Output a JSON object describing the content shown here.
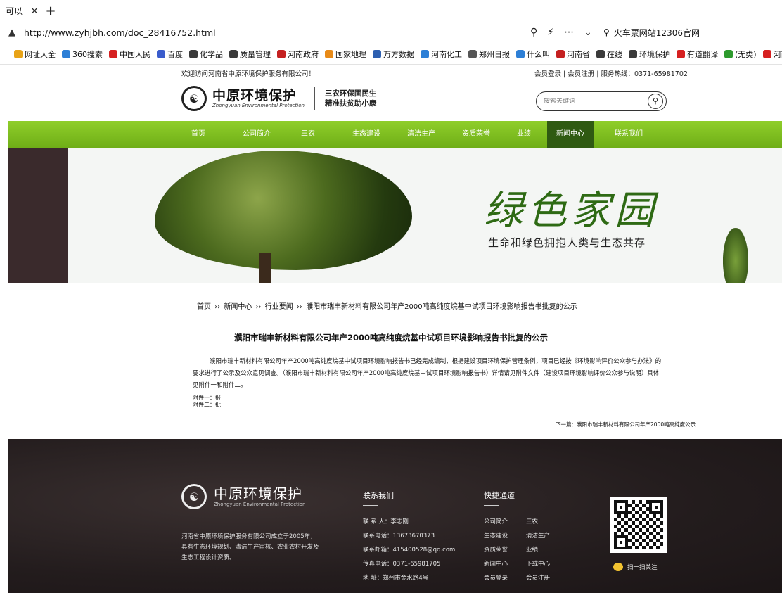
{
  "browser": {
    "tab_title": "可以",
    "tab_close": "×",
    "tab_new": "+",
    "url": "http://www.zyhjbh.com/doc_28416752.html",
    "zoom_icon": "zoom-icon",
    "search_text": "火车票网站12306官网",
    "bookmarks": [
      {
        "label": "网址大全",
        "color": "#e8a317"
      },
      {
        "label": "360搜索",
        "color": "#2d7fd6"
      },
      {
        "label": "中国人民",
        "color": "#d62020"
      },
      {
        "label": "百度",
        "color": "#3a5ccc"
      },
      {
        "label": "化学品",
        "color": "#3a3a3a"
      },
      {
        "label": "质量管理",
        "color": "#3a3a3a"
      },
      {
        "label": "河南政府",
        "color": "#c42020"
      },
      {
        "label": "国家地理",
        "color": "#e88a17"
      },
      {
        "label": "万方数据",
        "color": "#2d5fb0"
      },
      {
        "label": "河南化工",
        "color": "#2d7fd6"
      },
      {
        "label": "郑州日报",
        "color": "#555555"
      },
      {
        "label": "什么叫",
        "color": "#2d7fd6"
      },
      {
        "label": "河南省",
        "color": "#c42020"
      },
      {
        "label": "在线",
        "color": "#3a3a3a"
      },
      {
        "label": "环境保护",
        "color": "#3a3a3a"
      },
      {
        "label": "有道翻译",
        "color": "#d62020"
      },
      {
        "label": "(无类)",
        "color": "#2d9a2d"
      },
      {
        "label": "河南省",
        "color": "#d62020"
      }
    ]
  },
  "site": {
    "welcome": "欢迎访问河南省中原环境保护服务有限公司！",
    "top_links": "会员登录 | 会员注册 | 服务热线：0371-65981702",
    "logo_cn": "中原环境保护",
    "logo_en": "Zhongyuan Environmental Protection",
    "slogan_line1": "三农环保固民生",
    "slogan_line2": "精准扶贫助小康",
    "search_placeholder": "搜索关键词"
  },
  "nav": [
    {
      "label": "首页",
      "active": false
    },
    {
      "label": "公司简介",
      "active": false
    },
    {
      "label": "三农",
      "active": false
    },
    {
      "label": "生态建设",
      "active": false
    },
    {
      "label": "清洁生产",
      "active": false
    },
    {
      "label": "资质荣誉",
      "active": false
    },
    {
      "label": "业绩",
      "active": false
    },
    {
      "label": "新闻中心",
      "active": true
    },
    {
      "label": "联系我们",
      "active": false
    }
  ],
  "banner": {
    "title": "绿色家园",
    "subtitle": "生命和绿色拥抱人类与生态共存"
  },
  "breadcrumb": {
    "home": "首页",
    "sep": "››",
    "section": "新闻中心",
    "category": "行业要闻",
    "current": "濮阳市瑞丰新材料有限公司年产2000吨高纯度烷基中试项目环境影响报告书批复的公示"
  },
  "article": {
    "title": "濮阳市瑞丰新材料有限公司年产2000吨高纯度烷基中试项目环境影响报告书批复的公示",
    "body": "濮阳市瑞丰新材料有限公司年产2000吨高纯度烷基中试项目环境影响报告书已经完成编制，根据建设项目环境保护管理条例，项目已经按《环境影响评价公众参与办法》的要求进行了公示及公众意见调查。（濮阳市瑞丰新材料有限公司年产2000吨高纯度烷基中试项目环境影响报告书）详情请见附件文件（建设项目环境影响评价公众参与说明）具体见附件一和附件二。",
    "meta1": "附件一：报",
    "meta2": "附件二：批",
    "next": "下一篇：濮阳市瑞丰新材料有限公司年产2000吨高纯度公示"
  },
  "footer": {
    "logo_cn": "中原环境保护",
    "logo_en": "Zhongyuan Environmental Protection",
    "description": "河南省中原环境保护服务有限公司成立于2005年，具有生态环境规划、清洁生产审核、农业农村开发及生态工程设计资质。",
    "contact_title": "联系我们",
    "contact_person": "联 系 人：李志刚",
    "contact_phone": "联系电话：13673670373",
    "contact_email": "联系邮箱：415400528@qq.com",
    "contact_fax": "传真电话：0371-65981705",
    "contact_address": "地 址：郑州市金水路4号",
    "links_title": "快捷通道",
    "links": [
      "公司简介",
      "三农",
      "生态建设",
      "清洁生产",
      "资质荣誉",
      "业绩",
      "新闻中心",
      "下载中心",
      "会员登录",
      "会员注册"
    ],
    "scan_label": "扫一扫关注"
  }
}
